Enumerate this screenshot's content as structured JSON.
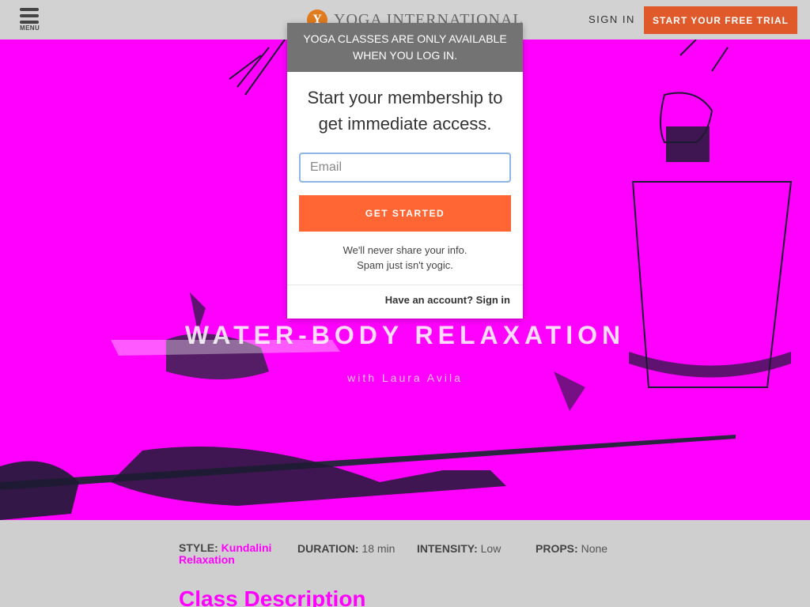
{
  "header": {
    "menu_label": "MENU",
    "logo_text": "YOGA INTERNATIONAL",
    "logo_mark": "Y",
    "sign_in": "SIGN IN",
    "trial_button": "START YOUR FREE TRIAL"
  },
  "hero": {
    "title": "WATER-BODY RELAXATION",
    "subtitle": "with Laura Avila"
  },
  "modal": {
    "banner": "YOGA CLASSES ARE ONLY AVAILABLE WHEN YOU LOG IN.",
    "heading": "Start your membership to get immediate access.",
    "email_placeholder": "Email",
    "email_value": "",
    "cta": "GET STARTED",
    "privacy_line1": "We'll never share your info.",
    "privacy_line2": "Spam just isn't yogic.",
    "footer_text": "Have an account?",
    "footer_link": "Sign in"
  },
  "class_meta": {
    "style_label": "STYLE:",
    "style_value": "Kundalini Relaxation",
    "duration_label": "DURATION:",
    "duration_value": "18 min",
    "intensity_label": "INTENSITY:",
    "intensity_value": "Low",
    "props_label": "PROPS:",
    "props_value": "None"
  },
  "section": {
    "title": "Class Description"
  },
  "colors": {
    "accent": "#e0592a",
    "cta": "#ff6633",
    "hero": "#ff00ff",
    "banner": "#737373"
  }
}
